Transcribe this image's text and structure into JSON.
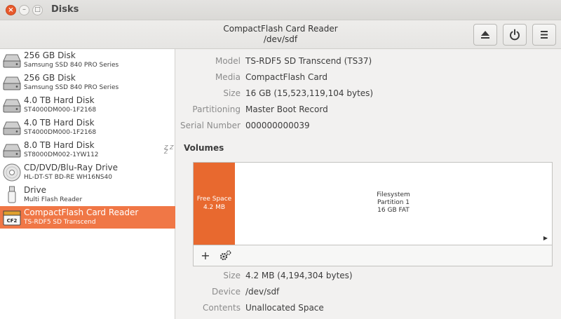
{
  "window": {
    "app_title": "Disks",
    "close_glyph": "×",
    "min_glyph": "–",
    "max_glyph": "□"
  },
  "header": {
    "title": "CompactFlash Card Reader",
    "subtitle": "/dev/sdf",
    "eject_icon": "eject-icon",
    "power_icon": "power-icon",
    "menu_icon": "menu-icon"
  },
  "sidebar": {
    "sleep_glyph": "Z Z Z",
    "devices": [
      {
        "name": "256 GB Disk",
        "sub": "Samsung SSD 840 PRO Series",
        "icon": "hard-disk-icon"
      },
      {
        "name": "256 GB Disk",
        "sub": "Samsung SSD 840 PRO Series",
        "icon": "hard-disk-icon"
      },
      {
        "name": "4.0 TB Hard Disk",
        "sub": "ST4000DM000-1F2168",
        "icon": "hard-disk-icon"
      },
      {
        "name": "4.0 TB Hard Disk",
        "sub": "ST4000DM000-1F2168",
        "icon": "hard-disk-icon"
      },
      {
        "name": "8.0 TB Hard Disk",
        "sub": "ST8000DM002-1YW112",
        "icon": "hard-disk-icon"
      },
      {
        "name": "CD/DVD/Blu-Ray Drive",
        "sub": "HL-DT-ST BD-RE  WH16NS40",
        "icon": "optical-disc-icon"
      },
      {
        "name": "Drive",
        "sub": "Multi Flash Reader",
        "icon": "usb-drive-icon"
      },
      {
        "name": "CompactFlash Card Reader",
        "sub": "TS-RDF5 SD  Transcend",
        "icon": "compactflash-card-icon",
        "card_label": "CF2"
      }
    ]
  },
  "properties": [
    {
      "key": "Model",
      "value": "TS-RDF5 SD  Transcend (TS37)"
    },
    {
      "key": "Media",
      "value": "CompactFlash Card"
    },
    {
      "key": "Size",
      "value": "16 GB (15,523,119,104 bytes)"
    },
    {
      "key": "Partitioning",
      "value": "Master Boot Record"
    },
    {
      "key": "Serial Number",
      "value": "000000000039"
    }
  ],
  "volumes": {
    "heading": "Volumes",
    "free_space": {
      "label": "Free Space",
      "size": "4.2 MB"
    },
    "filesystem": {
      "line1": "Filesystem",
      "line2": "Partition 1",
      "line3": "16 GB FAT"
    },
    "arrow_glyph": "▶",
    "add_glyph": "+",
    "gear_icon": "gears-icon"
  },
  "volume_properties": [
    {
      "key": "Size",
      "value": "4.2 MB (4,194,304 bytes)"
    },
    {
      "key": "Device",
      "value": "/dev/sdf"
    },
    {
      "key": "Contents",
      "value": "Unallocated Space"
    }
  ],
  "colors": {
    "accent": "#f07746",
    "free_space": "#e8692f",
    "close_button": "#e8592c"
  }
}
